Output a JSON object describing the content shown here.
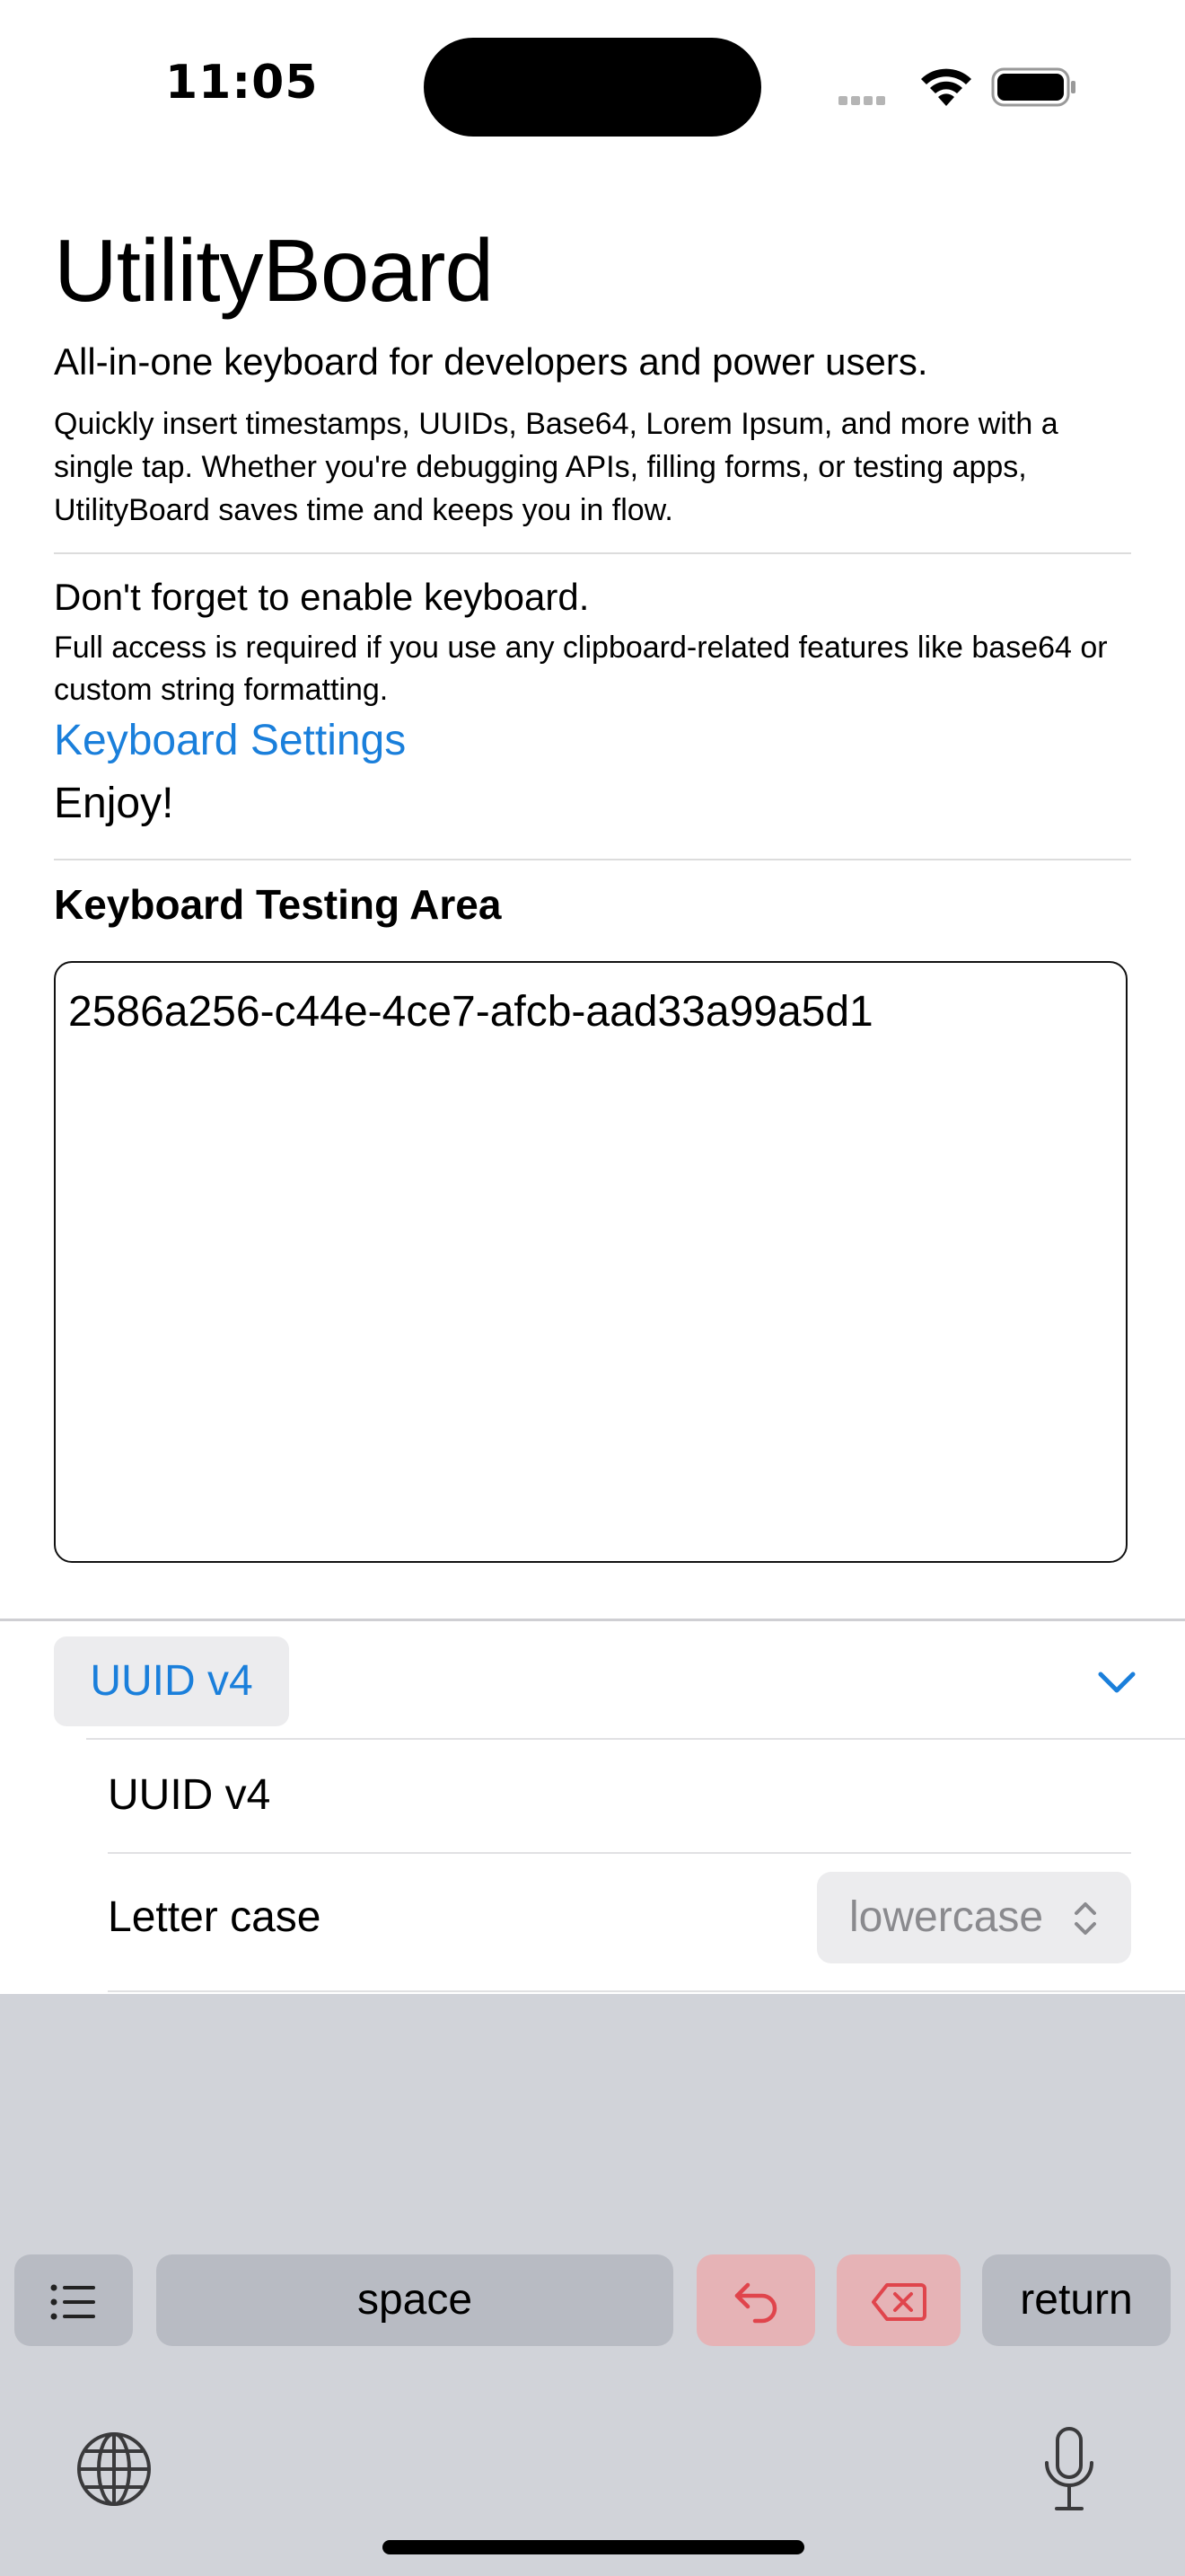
{
  "status_bar": {
    "time": "11:05",
    "icons": [
      "signal-dots-icon",
      "wifi-icon",
      "battery-icon"
    ]
  },
  "header": {
    "title": "UtilityBoard",
    "subtitle": "All-in-one keyboard for developers and power users.",
    "description": "Quickly insert timestamps, UUIDs, Base64, Lorem Ipsum, and more with a single tap. Whether you're debugging APIs, filling forms, or testing apps, UtilityBoard saves time and keeps you in flow."
  },
  "enable_section": {
    "heading": "Don't forget to enable keyboard.",
    "note": "Full access is required if you use any clipboard-related features like base64 or custom string formatting.",
    "link_label": "Keyboard Settings",
    "closing": "Enjoy!"
  },
  "testing_area": {
    "title": "Keyboard Testing Area",
    "value": "2586a256-c44e-4ce7-afcb-aad33a99a5d1"
  },
  "keyboard_panel": {
    "selected_format": "UUID v4",
    "options": [
      {
        "label": "UUID v4"
      },
      {
        "label": "Letter case",
        "value": "lowercase"
      }
    ]
  },
  "keyboard_keys": {
    "list_icon": "list-icon",
    "space_label": "space",
    "undo_icon": "undo-icon",
    "delete_icon": "delete-icon",
    "return_label": "return",
    "globe_icon": "globe-icon",
    "mic_icon": "microphone-icon"
  },
  "colors": {
    "accent": "#1a7fdb",
    "danger": "#e0454c",
    "keyboard_bg": "#d1d3d9",
    "key_bg": "#b8bbc3",
    "danger_key_bg": "#e6b3b6"
  }
}
